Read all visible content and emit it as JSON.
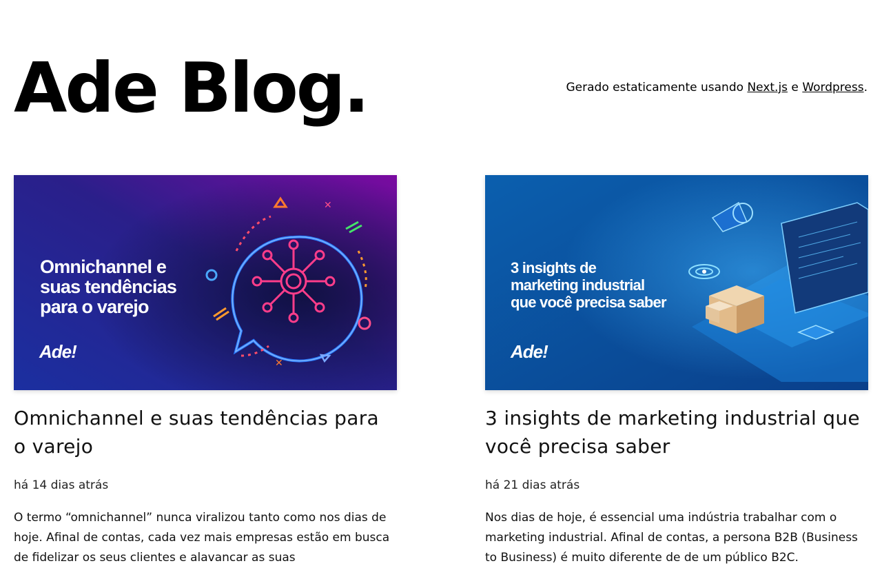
{
  "site": {
    "title": "Ade Blog.",
    "intro_prefix": "Gerado estaticamente usando ",
    "intro_link_1": "Next.js",
    "intro_middle": " e ",
    "intro_link_2": "Wordpress",
    "intro_suffix": "."
  },
  "posts": [
    {
      "cover": {
        "headline": [
          "Omnichannel e",
          "suas tendências",
          "para o varejo"
        ],
        "logo": "Ade!",
        "bg_from": "#1a2a8c",
        "bg_to": "#3a0a55",
        "accent": "#ff2e7e"
      },
      "title": "Omnichannel e suas tendências para o varejo",
      "date": "há 14 dias atrás",
      "excerpt": "O termo “omnichannel” nunca viralizou tanto como nos dias de hoje. Afinal de contas, cada vez mais empresas estão em busca de fidelizar os seus clientes e alavancar as suas"
    },
    {
      "cover": {
        "headline": [
          "3 insights de",
          "marketing industrial",
          "que você precisa saber"
        ],
        "logo": "Ade!",
        "bg_from": "#0a5aa8",
        "bg_to": "#0d3f86",
        "accent": "#4fb8ff"
      },
      "title": "3 insights de marketing industrial que você precisa saber",
      "date": "há 21 dias atrás",
      "excerpt": "Nos dias de hoje, é essencial uma indústria trabalhar com o marketing industrial. Afinal de contas, a persona B2B (Business to Business) é muito diferente de de um público B2C."
    }
  ]
}
